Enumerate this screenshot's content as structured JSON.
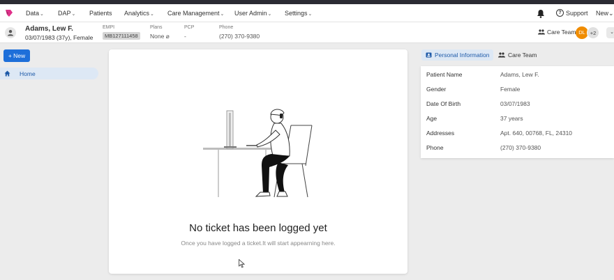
{
  "nav": {
    "items": [
      {
        "label": "Data",
        "dropdown": true
      },
      {
        "label": "DAP",
        "dropdown": true
      },
      {
        "label": "Patients",
        "dropdown": false
      },
      {
        "label": "Analytics",
        "dropdown": true
      },
      {
        "label": "Care Management",
        "dropdown": true
      },
      {
        "label": "User Admin",
        "dropdown": true
      },
      {
        "label": "Settings",
        "dropdown": true
      }
    ],
    "chevron": "⌄",
    "support_label": "Support",
    "support_glyph": "?",
    "new_label": "New",
    "new_chevron": "⌄"
  },
  "patient": {
    "name": "Adams, Lew F.",
    "subtitle": "03/07/1983 (37y), Female",
    "empi_label": "EMPI",
    "empi_value": "MB127111458",
    "plans_label": "Plans",
    "plans_value": "None ⌀",
    "pcp_label": "PCP",
    "pcp_value": "-",
    "phone_label": "Phone",
    "phone_value": "(270) 370-9380",
    "care_team_label": "Care Team",
    "care_team_initials": "DL",
    "care_team_more": "+2",
    "dropdown_glyph": "⌄"
  },
  "sidebar": {
    "new_button": "+ New",
    "home_label": "Home"
  },
  "empty_state": {
    "title": "No ticket has been logged yet",
    "subtitle": "Once you have logged a ticket.It will start appearning here."
  },
  "right_panel": {
    "tabs": [
      "Personal Information",
      "Care Team"
    ],
    "active_tab": 0,
    "fields": [
      {
        "label": "Patient Name",
        "value": "Adams, Lew F."
      },
      {
        "label": "Gender",
        "value": "Female"
      },
      {
        "label": "Date Of Birth",
        "value": "03/07/1983"
      },
      {
        "label": "Age",
        "value": "37 years"
      },
      {
        "label": "Addresses",
        "value": "Apt. 640, 00768, FL, 24310"
      },
      {
        "label": "Phone",
        "value": "(270) 370-9380"
      }
    ]
  },
  "colors": {
    "accent": "#1e6fd9",
    "active_bg": "#dde8f5",
    "care_team_avatar": "#f08c00",
    "logo": "#e0308a"
  },
  "icons": {
    "logo": "brand-logo-icon",
    "bell": "bell-icon",
    "support": "help-circle-icon",
    "avatar": "person-icon",
    "care_team": "group-icon",
    "home": "home-icon",
    "personal_info": "id-card-icon",
    "cursor": "mouse-pointer-icon"
  }
}
